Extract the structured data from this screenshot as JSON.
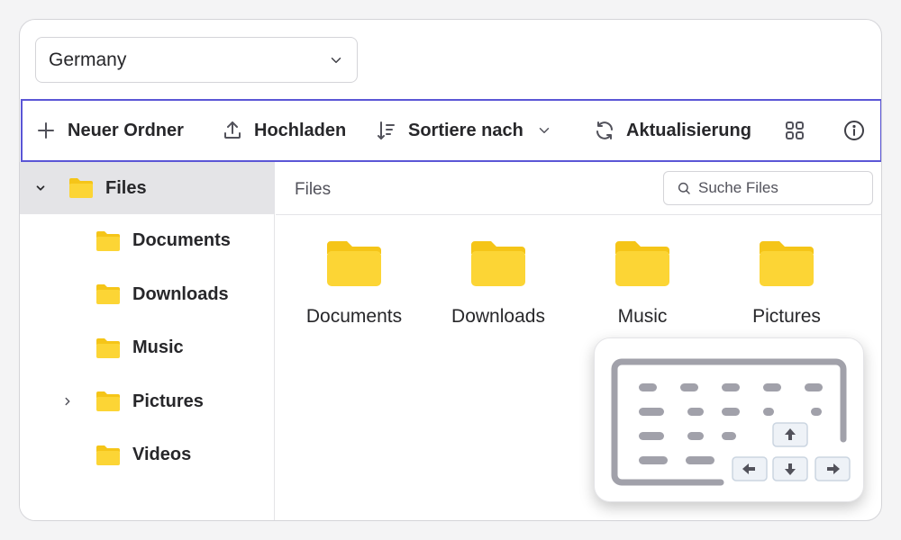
{
  "country_select": {
    "value": "Germany"
  },
  "toolbar": {
    "new_folder": "Neuer Ordner",
    "upload": "Hochladen",
    "sort": "Sortiere nach",
    "refresh": "Aktualisierung"
  },
  "sidebar": {
    "root": "Files",
    "items": [
      {
        "label": "Documents"
      },
      {
        "label": "Downloads"
      },
      {
        "label": "Music"
      },
      {
        "label": "Pictures"
      },
      {
        "label": "Videos"
      }
    ]
  },
  "breadcrumb": "Files",
  "search": {
    "placeholder": "Suche Files"
  },
  "grid": [
    {
      "label": "Documents"
    },
    {
      "label": "Downloads"
    },
    {
      "label": "Music"
    },
    {
      "label": "Pictures"
    }
  ],
  "colors": {
    "accent": "#5b56d6",
    "folder": "#fcd535",
    "folder_tab": "#f5c518",
    "selected_bg": "#e4e4e7"
  },
  "icons": [
    "plus-icon",
    "upload-icon",
    "sort-icon",
    "chevron-down-icon",
    "refresh-icon",
    "grid-view-icon",
    "info-icon",
    "folder-icon",
    "search-icon",
    "keyboard-icon"
  ]
}
